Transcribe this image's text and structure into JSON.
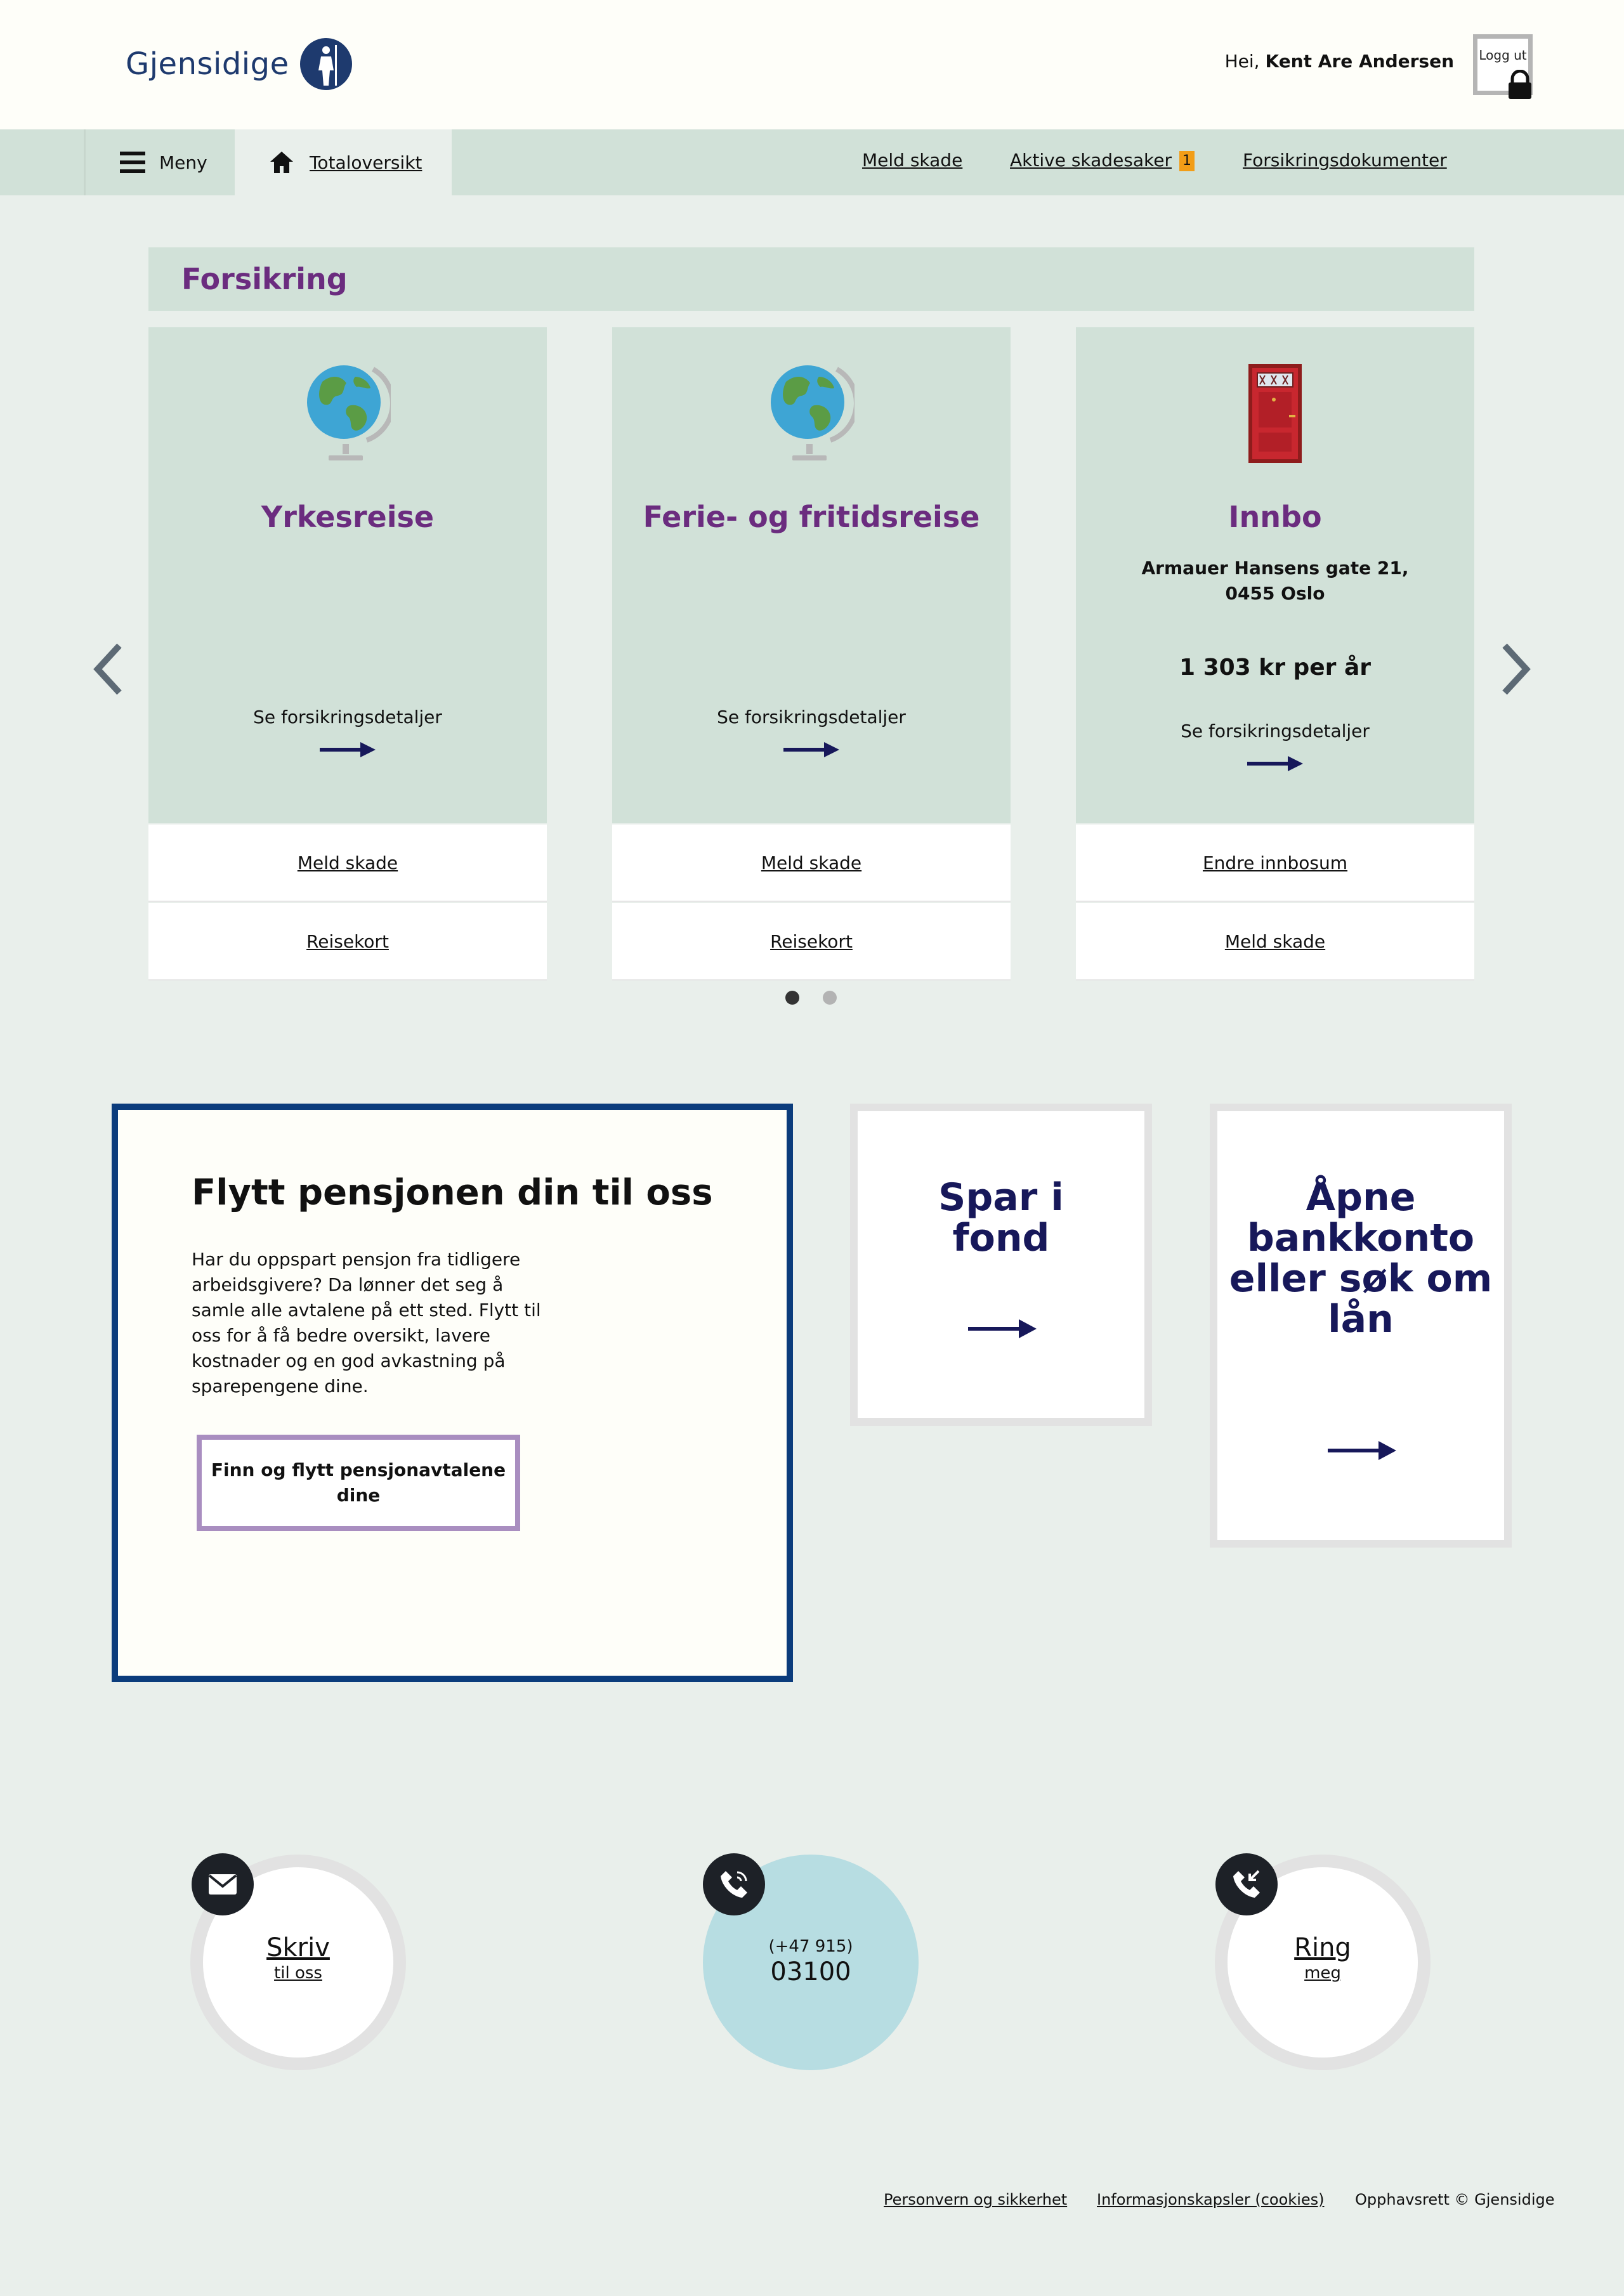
{
  "header": {
    "logo_text": "Gjensidige",
    "greeting_prefix": "Hei, ",
    "user_name": "Kent Are Andersen",
    "logout_label": "Logg ut"
  },
  "nav": {
    "menu_label": "Meny",
    "home_label": "Totaloversikt",
    "links": [
      "Meld skade",
      "Aktive skadesaker",
      "Forsikringsdokumenter"
    ],
    "active_claims_count": "1"
  },
  "insurance": {
    "section_title": "Forsikring",
    "cards": [
      {
        "title": "Yrkesreise",
        "icon": "globe-icon",
        "details_link": "Se forsikringsdetaljer",
        "actions": [
          "Meld skade",
          "Reisekort"
        ]
      },
      {
        "title": "Ferie- og fritidsreise",
        "icon": "globe-icon",
        "details_link": "Se forsikringsdetaljer",
        "actions": [
          "Meld skade",
          "Reisekort"
        ]
      },
      {
        "title": "Innbo",
        "icon": "door-icon",
        "address": "Armauer Hansens gate 21, 0455 Oslo",
        "price": "1 303 kr per år",
        "details_link": "Se forsikringsdetaljer",
        "actions": [
          "Endre innbosum",
          "Meld skade"
        ]
      }
    ],
    "carousel": {
      "pages": 2,
      "active_page": 1
    }
  },
  "promo": {
    "main": {
      "title": "Flytt pensjonen din til oss",
      "body": "Har du oppspart pensjon fra tidligere arbeidsgivere? Da lønner det seg å samle alle avtalene på ett sted. Flytt til oss for å få bedre oversikt, lavere kostnader og en god avkastning på sparepengene dine.",
      "button": "Finn og flytt pensjonavtalene dine"
    },
    "tiles": [
      {
        "title": "Spar i fond"
      },
      {
        "title": "Åpne bankkonto eller søk om lån"
      }
    ]
  },
  "contact": [
    {
      "big": "Skriv",
      "small": "til oss",
      "icon": "envelope-icon"
    },
    {
      "small": "(+47 915)",
      "big": "03100",
      "icon": "phone-icon"
    },
    {
      "big": "Ring",
      "small": "meg",
      "icon": "phone-callback-icon"
    }
  ],
  "footer": {
    "links": [
      "Personvern og sikkerhet",
      "Informasjonskapsler (cookies)"
    ],
    "copyright": "Opphavsrett © Gjensidige"
  },
  "colors": {
    "brand_blue": "#1e3a6e",
    "purple_heading": "#6b2c7f",
    "nav_green": "#d1e1d8",
    "page_bg": "#e9efeb",
    "badge_orange": "#f29d17",
    "promo_border": "#0b3c7c"
  }
}
